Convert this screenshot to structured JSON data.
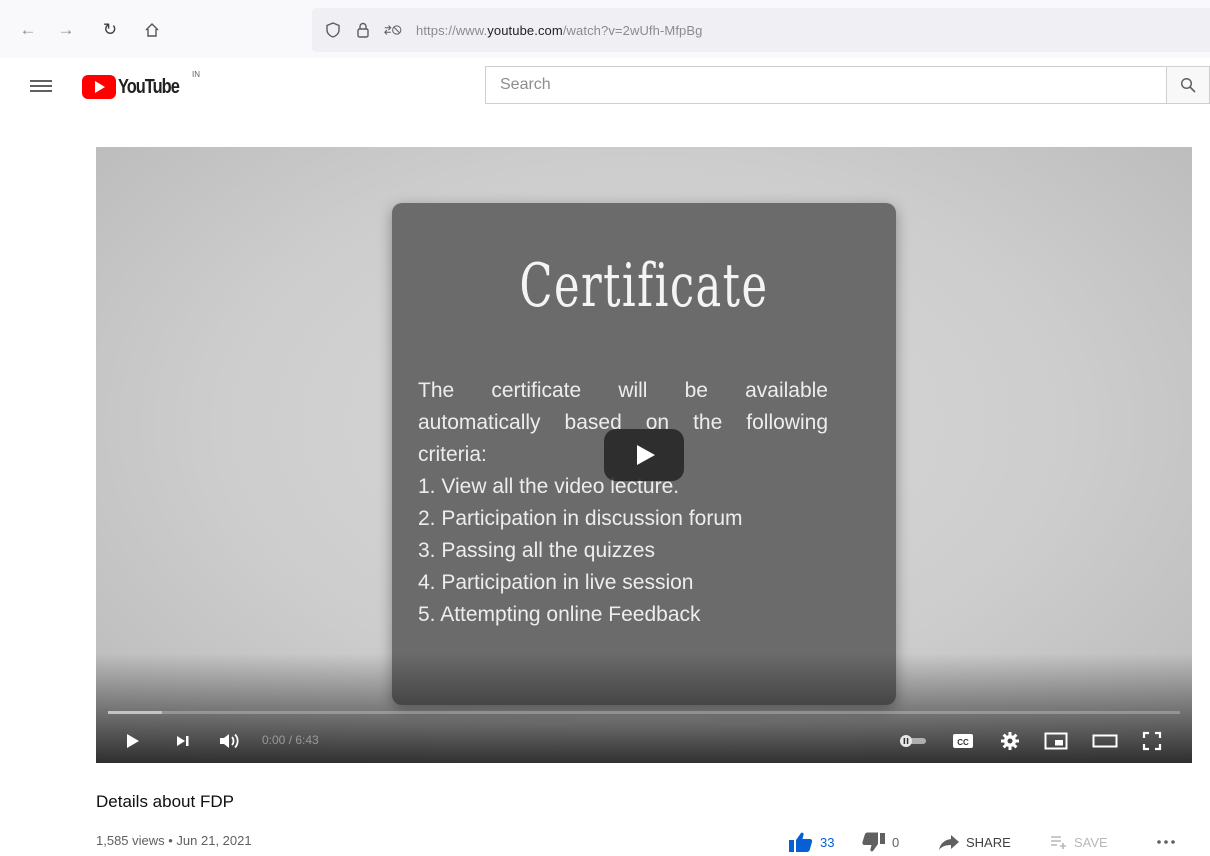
{
  "browser": {
    "url_prefix": "https://www.",
    "url_host": "youtube.com",
    "url_path": "/watch?v=2wUfh-MfpBg"
  },
  "header": {
    "logo_text": "YouTube",
    "country_code": "IN",
    "search_placeholder": "Search"
  },
  "video": {
    "slide_title": "Certificate",
    "slide_intro": "The certificate will be available automatically based on the following criteria:",
    "slide_items": [
      "1. View all the video lecture.",
      "2. Participation in discussion forum",
      "3. Passing all the quizzes",
      "4. Participation in live session",
      "5. Attempting online Feedback"
    ],
    "time_display": "0:00 / 6:43",
    "loaded_fraction": 0.05
  },
  "info": {
    "title": "Details about FDP",
    "meta": "1,585 views • Jun 21, 2021",
    "like_count": "33",
    "dislike_count": "0",
    "share_label": "SHARE",
    "save_label": "SAVE"
  },
  "colors": {
    "brand_red": "#ff0000",
    "like_blue": "#065fd4"
  }
}
